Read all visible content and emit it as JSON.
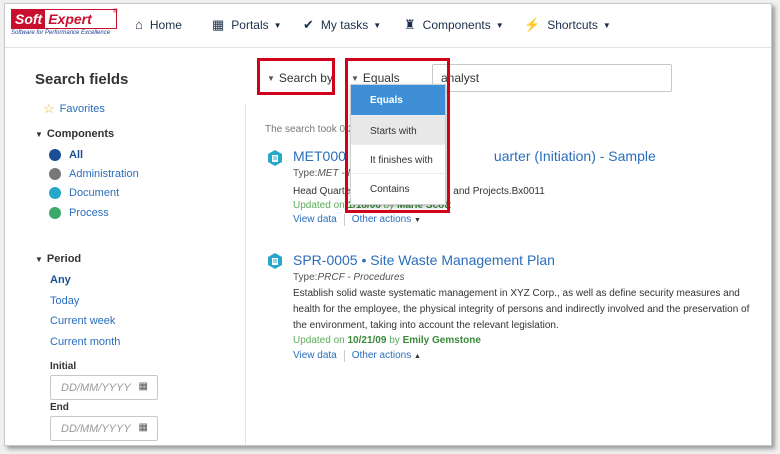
{
  "logo": {
    "soft": "Soft",
    "expert": "Expert",
    "reg": "®",
    "tagline": "Software for Performance Excellence"
  },
  "nav": [
    {
      "label": "Home",
      "icon": "home-icon",
      "glyph": "⌂",
      "caret": ""
    },
    {
      "label": "Portals",
      "icon": "portals-icon",
      "glyph": "▦",
      "caret": "▼"
    },
    {
      "label": "My tasks",
      "icon": "check-icon",
      "glyph": "✔",
      "caret": "▼"
    },
    {
      "label": "Components",
      "icon": "trophy-icon",
      "glyph": "♜",
      "caret": "▼"
    },
    {
      "label": "Shortcuts",
      "icon": "bolt-icon",
      "glyph": "⚡",
      "caret": "▼"
    }
  ],
  "sidebar": {
    "title": "Search fields",
    "favorites": "Favorites",
    "components_title": "Components",
    "components": [
      "All",
      "Administration",
      "Document",
      "Process"
    ],
    "period_title": "Period",
    "periods": [
      "Any",
      "Today",
      "Current week",
      "Current month"
    ],
    "initial_label": "Initial",
    "end_label": "End",
    "date_placeholder": "DD/MM/YYYY"
  },
  "search": {
    "search_by": "Search by",
    "operator": "Equals",
    "query": "analyst"
  },
  "dropdown": {
    "options": [
      "Equals",
      "Starts with",
      "It finishes with",
      "Contains"
    ],
    "selected": "Equals",
    "hovered": "Starts with"
  },
  "results": {
    "took_text": "The search took 0.2",
    "items": [
      {
        "title_left": "MET000",
        "title_right": "uarter (Initiation) - Sample",
        "type_label": "Type:",
        "type_value": "MET - M",
        "desc_left": "Head Quarte",
        "desc_right": "and Projects.Bx0011",
        "updated_prefix": "Updated on",
        "updated_date": "1/18/06",
        "updated_by": "by",
        "updated_user": "Marie Scott",
        "view": "View data",
        "other": "Other actions",
        "other_caret": "▼"
      },
      {
        "title": "SPR-0005 • Site Waste Management Plan",
        "type_label": "Type:",
        "type_value": "PRCF - Procedures",
        "desc": "Establish solid waste systematic management in XYZ Corp., as well as define security measures and health for the employee, the physical integrity of persons and indirectly involved and the preservation of the environment, taking into account the relevant legislation.",
        "updated_prefix": "Updated on",
        "updated_date": "10/21/09",
        "updated_by": "by",
        "updated_user": "Emily Gemstone",
        "view": "View data",
        "other": "Other actions",
        "other_caret": "▲"
      }
    ]
  },
  "colors": {
    "brand_red": "#c8102e",
    "link_blue": "#2a6ebb",
    "highlight_red": "#d0021b",
    "dropdown_active": "#3f8fd6",
    "updated_green": "#5cad5c"
  }
}
